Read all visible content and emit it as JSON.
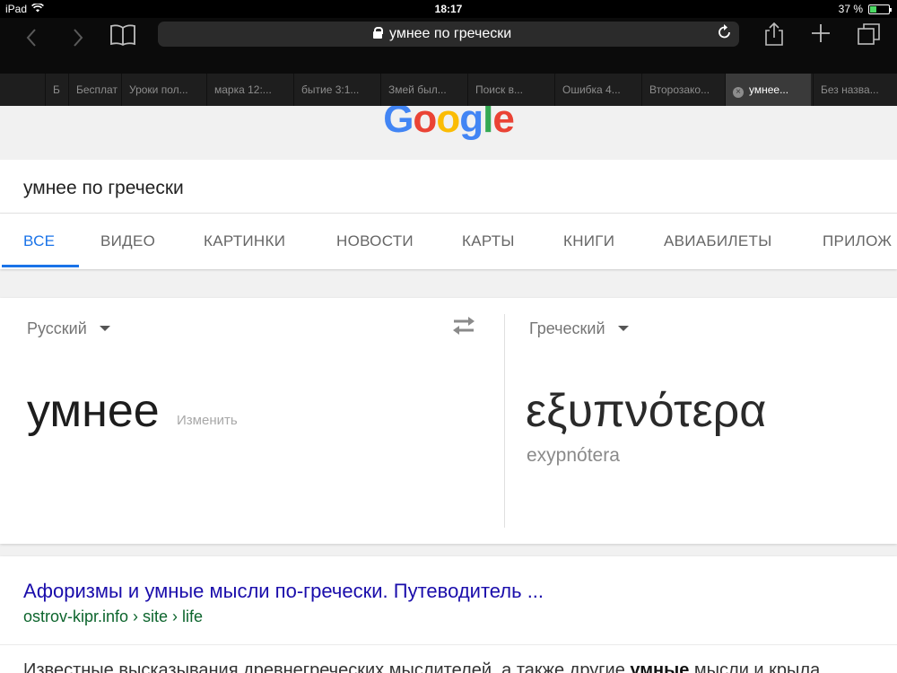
{
  "status": {
    "device": "iPad",
    "time": "18:17",
    "battery": "37 %",
    "battery_level": 0.37,
    "battery_color": "#4cd964"
  },
  "browser": {
    "url_text": "умнее по гречески",
    "icons": {
      "back": "chevron-left-icon",
      "forward": "chevron-right-icon",
      "bookmarks": "book-icon",
      "reload": "reload-icon",
      "share": "share-icon",
      "new_tab": "plus-icon",
      "tabs": "tabs-icon"
    },
    "tabs": [
      {
        "label": "Б"
      },
      {
        "label": "Бесплат"
      },
      {
        "label": "Уроки пол..."
      },
      {
        "label": "марка 12:..."
      },
      {
        "label": "бытие 3:1..."
      },
      {
        "label": "Змей был..."
      },
      {
        "label": "Поиск в..."
      },
      {
        "label": "Ошибка 4..."
      },
      {
        "label": "Второзако..."
      },
      {
        "label": "умнее..."
      },
      {
        "label": "Без назва..."
      }
    ],
    "active_tab": 9
  },
  "google": {
    "logo": "Google",
    "query": "умнее по гречески",
    "nav": [
      "ВСЕ",
      "ВИДЕО",
      "КАРТИНКИ",
      "НОВОСТИ",
      "КАРТЫ",
      "КНИГИ",
      "АВИАБИЛЕТЫ",
      "ПРИЛОЖ"
    ],
    "accent": "#1a73e8"
  },
  "translate": {
    "source_lang": "Русский",
    "target_lang": "Греческий",
    "source_word": "умнее",
    "edit_link": "Изменить",
    "target_word": "εξυπνότερα",
    "transliteration": "exypnótera"
  },
  "result": {
    "title": "Афоризмы и умные мысли по-гречески. Путеводитель ...",
    "url": "ostrov-kipr.info › site › life",
    "snippet_pre": "Известные высказывания древнегреческих мыслителей, а также другие ",
    "snippet_bold": "умные",
    "snippet_post": " мысли и крыла"
  }
}
